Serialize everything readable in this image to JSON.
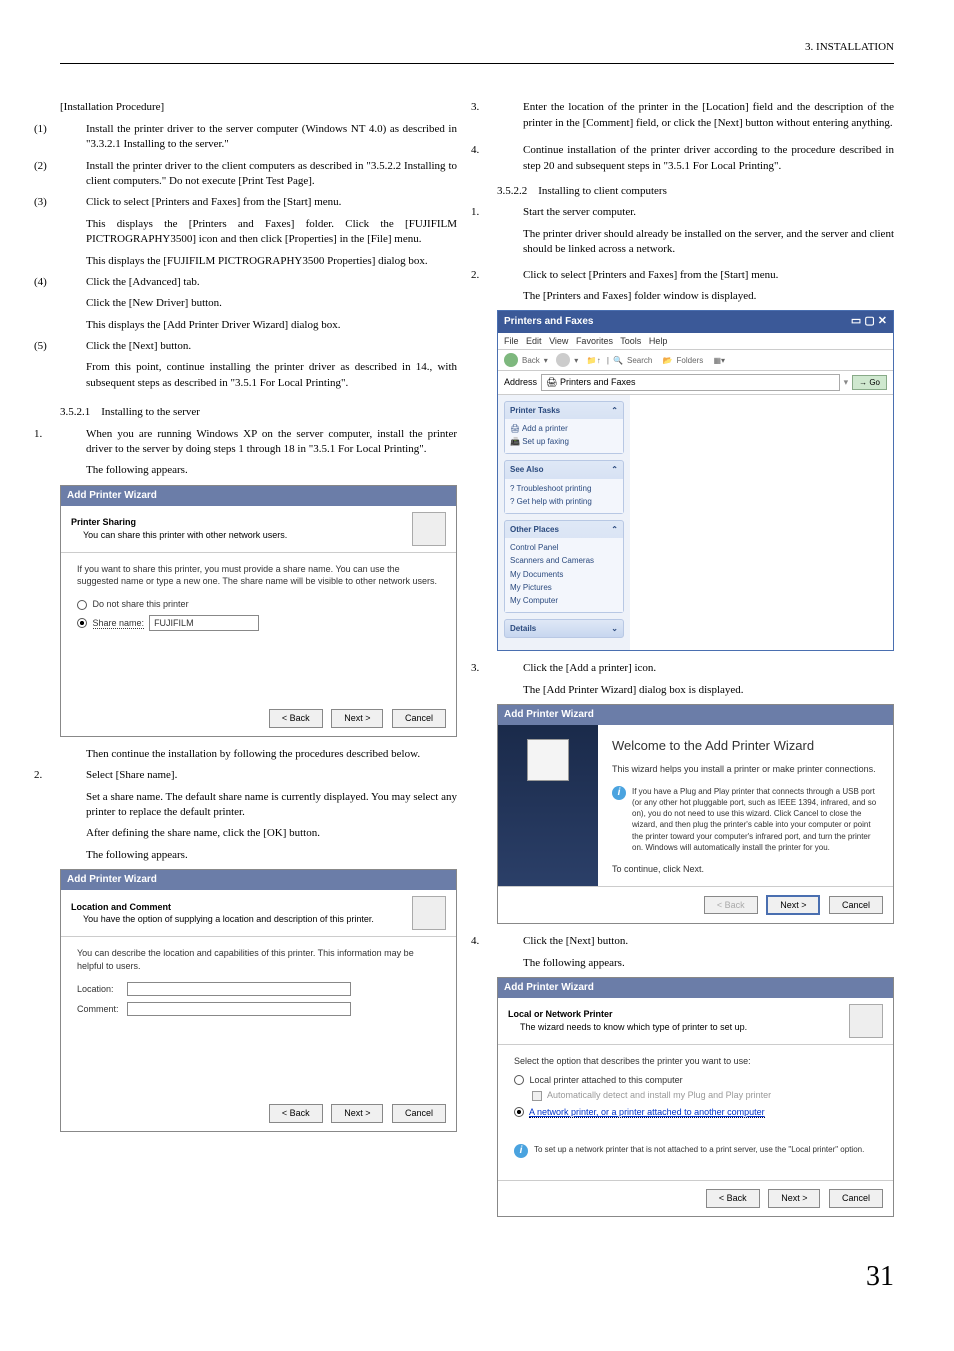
{
  "header": {
    "section": "3. INSTALLATION"
  },
  "left": {
    "proc_title": "[Installation Procedure]",
    "p1": {
      "n": "(1)",
      "t": "Install the printer driver to the server computer (Windows NT 4.0) as described in \"3.3.2.1 Installing to the server.\""
    },
    "p2": {
      "n": "(2)",
      "t": "Install the printer driver to the client computers as described in \"3.5.2.2 Installing to client computers.\" Do not execute [Print Test Page]."
    },
    "p3": {
      "n": "(3)",
      "t": "Click to select [Printers and Faxes] from the [Start] menu.",
      "t2": "This displays the [Printers and Faxes] folder. Click the [FUJIFILM PICTROGRAPHY3500] icon and then click [Properties] in the [File] menu.",
      "t3": "This displays the [FUJIFILM PICTROGRAPHY3500 Properties] dialog box."
    },
    "p4": {
      "n": "(4)",
      "t": "Click the [Advanced] tab.",
      "t2": "Click the [New Driver] button.",
      "t3": "This displays the [Add Printer Driver Wizard] dialog box."
    },
    "p5": {
      "n": "(5)",
      "t": "Click the [Next] button.",
      "t2": "From this point, continue installing the printer driver as described in 14., with subsequent steps as described in \"3.5.1 For Local Printing\"."
    },
    "sec1": {
      "num": "3.5.2.1",
      "title": "Installing to the server"
    },
    "s1": {
      "n": "1.",
      "t": "When you are running Windows XP on the server computer, install the printer driver to the server by doing steps 1 through 18 in \"3.5.1 For Local Printing\".",
      "t2": "The following appears."
    },
    "ss1": {
      "title": "Add Printer Wizard",
      "sub_heading": "Printer Sharing",
      "sub_text": "You can share this printer with other network users.",
      "body": "If you want to share this printer, you must provide a share name. You can use the suggested name or type a new one. The share name will be visible to other network users.",
      "opt1": "Do not share this printer",
      "opt2_label": "Share name:",
      "opt2_value": "FUJIFILM",
      "back": "< Back",
      "next": "Next >",
      "cancel": "Cancel"
    },
    "after1": "Then continue the installation by following the procedures described below.",
    "s2": {
      "n": "2.",
      "t": "Select [Share name].",
      "t2": "Set a share name. The default share name is currently displayed. You may select any printer to replace the default printer.",
      "t3": "After defining the share name, click the [OK] button.",
      "t4": "The following appears."
    },
    "ss2": {
      "title": "Add Printer Wizard",
      "sub_heading": "Location and Comment",
      "sub_text": "You have the option of supplying a location and description of this printer.",
      "body": "You can describe the location and capabilities of this printer. This information may be helpful to users.",
      "loc": "Location:",
      "com": "Comment:",
      "back": "< Back",
      "next": "Next >",
      "cancel": "Cancel"
    }
  },
  "right": {
    "s3": {
      "n": "3.",
      "t": "Enter the location of the printer in the [Location] field and the description of the printer in the [Comment] field, or click the [Next] button without entering anything."
    },
    "s4": {
      "n": "4.",
      "t": "Continue installation of the printer driver according to the procedure described in step 20 and subsequent steps in \"3.5.1 For Local Printing\"."
    },
    "sec2": {
      "num": "3.5.2.2",
      "title": "Installing to client computers"
    },
    "c1": {
      "n": "1.",
      "t": "Start the server computer.",
      "t2": "The printer driver should already be installed on the server, and the server and client should be linked across a network."
    },
    "c2": {
      "n": "2.",
      "t": "Click to select [Printers and Faxes] from the [Start] menu.",
      "t2": "The [Printers and Faxes] folder window is displayed."
    },
    "explorer": {
      "title": "Printers and Faxes",
      "menu": {
        "file": "File",
        "edit": "Edit",
        "view": "View",
        "fav": "Favorites",
        "tools": "Tools",
        "help": "Help"
      },
      "tb": {
        "back": "Back",
        "search": "Search",
        "folders": "Folders"
      },
      "addr_label": "Address",
      "addr_value": "Printers and Faxes",
      "go": "Go",
      "groups": {
        "tasks": {
          "h": "Printer Tasks",
          "i1": "Add a printer",
          "i2": "Set up faxing"
        },
        "see": {
          "h": "See Also",
          "i1": "Troubleshoot printing",
          "i2": "Get help with printing"
        },
        "other": {
          "h": "Other Places",
          "i1": "Control Panel",
          "i2": "Scanners and Cameras",
          "i3": "My Documents",
          "i4": "My Pictures",
          "i5": "My Computer"
        },
        "details": {
          "h": "Details"
        }
      }
    },
    "c3": {
      "n": "3.",
      "t": "Click the [Add a printer] icon.",
      "t2": "The [Add Printer Wizard] dialog box is displayed."
    },
    "ss_wiz": {
      "title": "Add Printer Wizard",
      "heading": "Welcome to the Add Printer Wizard",
      "p1": "This wizard helps you install a printer or make printer connections.",
      "info": "If you have a Plug and Play printer that connects through a USB port (or any other hot pluggable port, such as IEEE 1394, infrared, and so on), you do not need to use this wizard. Click Cancel to close the wizard, and then plug the printer's cable into your computer or point the printer toward your computer's infrared port, and turn the printer on. Windows will automatically install the printer for you.",
      "p2": "To continue, click Next.",
      "back": "< Back",
      "next": "Next >",
      "cancel": "Cancel"
    },
    "c4": {
      "n": "4.",
      "t": "Click the [Next] button.",
      "t2": "The following appears."
    },
    "ss_net": {
      "title": "Add Printer Wizard",
      "sub_heading": "Local or Network Printer",
      "sub_text": "The wizard needs to know which type of printer to set up.",
      "body": "Select the option that describes the printer you want to use:",
      "opt1": "Local printer attached to this computer",
      "opt1_sub": "Automatically detect and install my Plug and Play printer",
      "opt2": "A network printer, or a printer attached to another computer",
      "info": "To set up a network printer that is not attached to a print server, use the \"Local printer\" option.",
      "back": "< Back",
      "next": "Next >",
      "cancel": "Cancel"
    }
  },
  "pagenum": "31"
}
